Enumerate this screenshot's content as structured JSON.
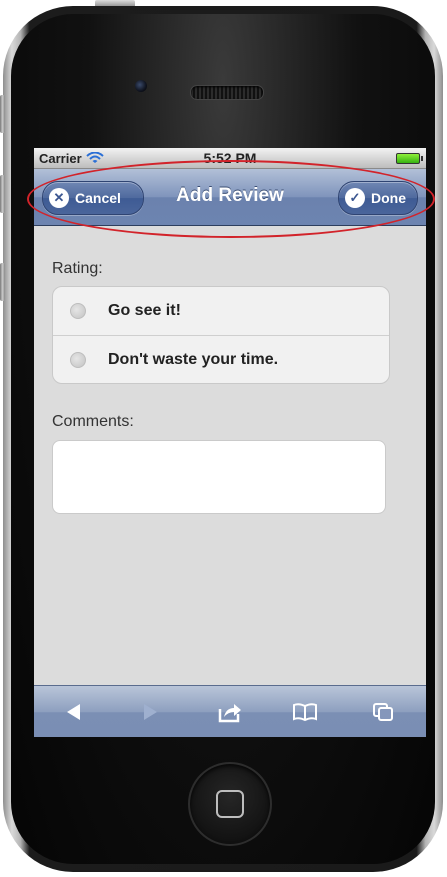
{
  "status_bar": {
    "carrier": "Carrier",
    "time": "5:52 PM"
  },
  "nav_bar": {
    "title": "Add Review",
    "cancel_label": "Cancel",
    "done_label": "Done"
  },
  "form": {
    "rating_label": "Rating:",
    "options": [
      "Go see it!",
      "Don't waste your time."
    ],
    "comments_label": "Comments:",
    "comments_value": ""
  },
  "toolbar": {
    "icons": [
      "back-arrow-icon",
      "forward-arrow-icon",
      "share-icon",
      "bookmarks-icon",
      "tabs-icon"
    ]
  },
  "colors": {
    "highlight": "#d2232a",
    "nav_bar": "#6d84b0",
    "screen_bg": "#dcdcdc"
  }
}
